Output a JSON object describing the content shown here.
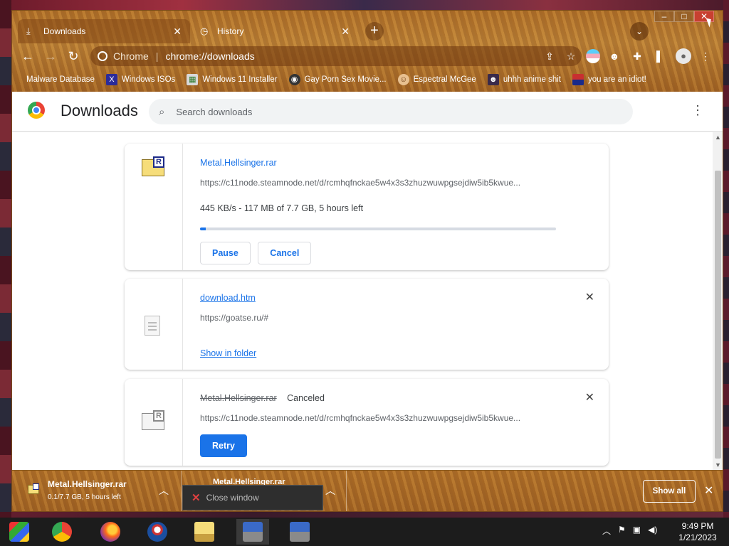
{
  "tabs": [
    {
      "label": "Downloads",
      "icon": "download-icon"
    },
    {
      "label": "History",
      "icon": "history-icon"
    }
  ],
  "toolbar": {
    "site_name": "Chrome",
    "url": "chrome://downloads"
  },
  "bookmarks": [
    {
      "label": "Malware Database"
    },
    {
      "label": "Windows ISOs"
    },
    {
      "label": "Windows 11 Installer"
    },
    {
      "label": "Gay Porn Sex Movie..."
    },
    {
      "label": "Espectral McGee"
    },
    {
      "label": "uhhh anime shit"
    },
    {
      "label": "you are an idiot!"
    }
  ],
  "page": {
    "title": "Downloads",
    "search_placeholder": "Search downloads"
  },
  "downloads": [
    {
      "file_name": "Metal.Hellsinger.rar",
      "url": "https://c11node.steamnode.net/d/rcmhqfnckae5w4x3s3zhuzwuwpgsejdiw5ib5kwue...",
      "progress_text": "445 KB/s - 117 MB of 7.7 GB, 5 hours left",
      "progress_fraction": 0.015,
      "pause_label": "Pause",
      "cancel_label": "Cancel"
    },
    {
      "file_name": "download.htm",
      "url": "https://goatse.ru/#",
      "show_in_folder_label": "Show in folder"
    },
    {
      "file_name": "Metal.Hellsinger.rar",
      "status": "Canceled",
      "url": "https://c11node.steamnode.net/d/rcmhqfnckae5w4x3s3zhuzwuwpgsejdiw5ib5kwue...",
      "retry_label": "Retry"
    }
  ],
  "shelf": {
    "item1_name": "Metal.Hellsinger.rar",
    "item1_status": "0.1/7.7 GB, 5 hours left",
    "item2_name": "Metal.Hellsinger.rar",
    "show_all_label": "Show all"
  },
  "tooltip": {
    "label": "Close window"
  },
  "clock": {
    "time": "9:49 PM",
    "date": "1/21/2023"
  },
  "colors": {
    "accent": "#1a73e8",
    "theme_bronze": "#b8782e"
  }
}
